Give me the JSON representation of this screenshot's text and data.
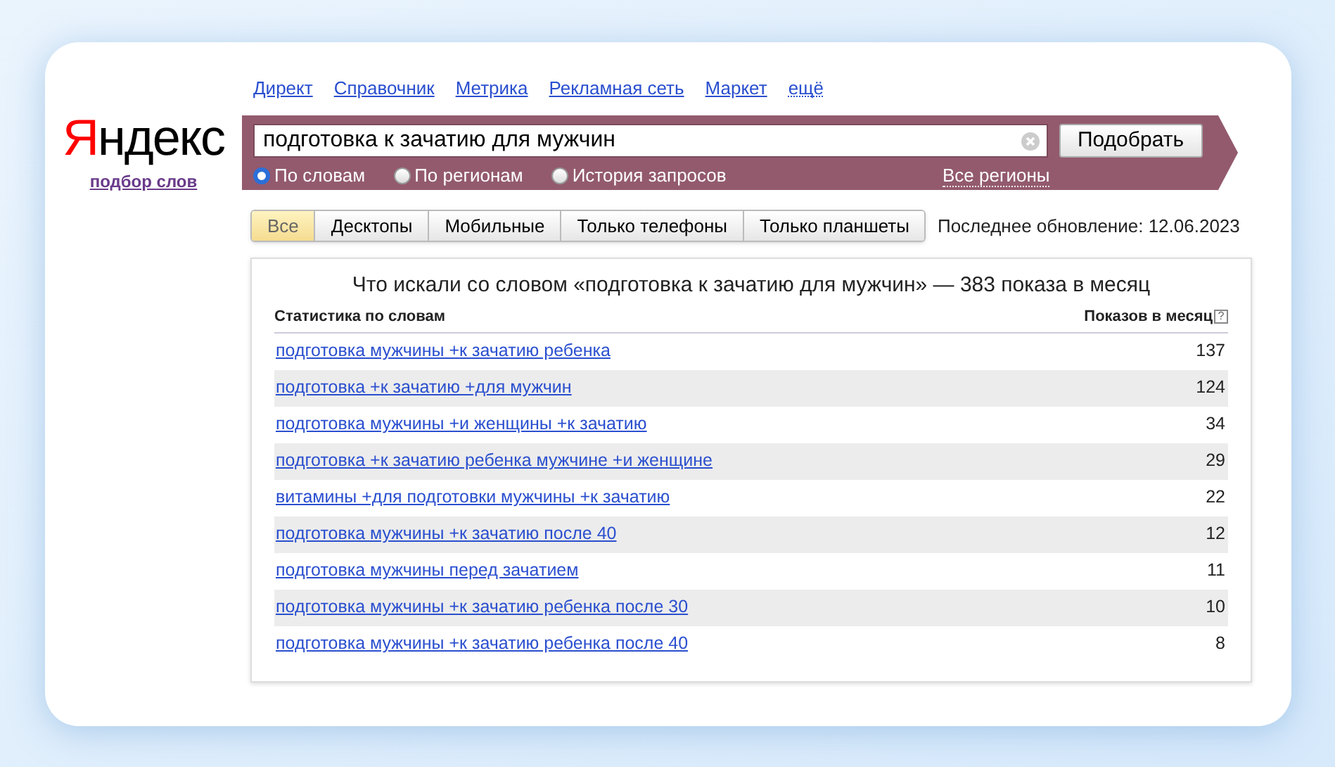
{
  "logo": {
    "first": "Я",
    "rest": "ндекс"
  },
  "service_link": "подбор слов",
  "top_links": [
    {
      "label": "Директ",
      "kind": "link"
    },
    {
      "label": "Справочник",
      "kind": "link"
    },
    {
      "label": "Метрика",
      "kind": "link"
    },
    {
      "label": "Рекламная сеть",
      "kind": "link"
    },
    {
      "label": "Маркет",
      "kind": "link"
    },
    {
      "label": "ещё",
      "kind": "dropdown"
    }
  ],
  "search": {
    "value": "подготовка к зачатию для мужчин",
    "button": "Подобрать"
  },
  "modes": [
    {
      "label": "По словам",
      "selected": true
    },
    {
      "label": "По регионам",
      "selected": false
    },
    {
      "label": "История запросов",
      "selected": false
    }
  ],
  "region_link": "Все регионы",
  "device_tabs": [
    {
      "label": "Все",
      "selected": true
    },
    {
      "label": "Десктопы",
      "selected": false
    },
    {
      "label": "Мобильные",
      "selected": false
    },
    {
      "label": "Только телефоны",
      "selected": false
    },
    {
      "label": "Только планшеты",
      "selected": false
    }
  ],
  "last_update": "Последнее обновление: 12.06.2023",
  "results": {
    "title": "Что искали со словом «подготовка к зачатию для мужчин» — 383 показа в месяц",
    "columns": [
      "Статистика по словам",
      "Показов в месяц"
    ],
    "help": "?",
    "rows": [
      {
        "phrase": "подготовка мужчины +к зачатию ребенка",
        "count": "137"
      },
      {
        "phrase": "подготовка +к зачатию +для мужчин",
        "count": "124"
      },
      {
        "phrase": "подготовка мужчины +и женщины +к зачатию",
        "count": "34"
      },
      {
        "phrase": "подготовка +к зачатию ребенка мужчине +и женщине",
        "count": "29"
      },
      {
        "phrase": "витамины +для подготовки мужчины +к зачатию",
        "count": "22"
      },
      {
        "phrase": "подготовка мужчины +к зачатию после 40",
        "count": "12"
      },
      {
        "phrase": "подготовка мужчины перед зачатием",
        "count": "11"
      },
      {
        "phrase": "подготовка мужчины +к зачатию ребенка после 30",
        "count": "10"
      },
      {
        "phrase": "подготовка мужчины +к зачатию ребенка после 40",
        "count": "8"
      }
    ]
  }
}
